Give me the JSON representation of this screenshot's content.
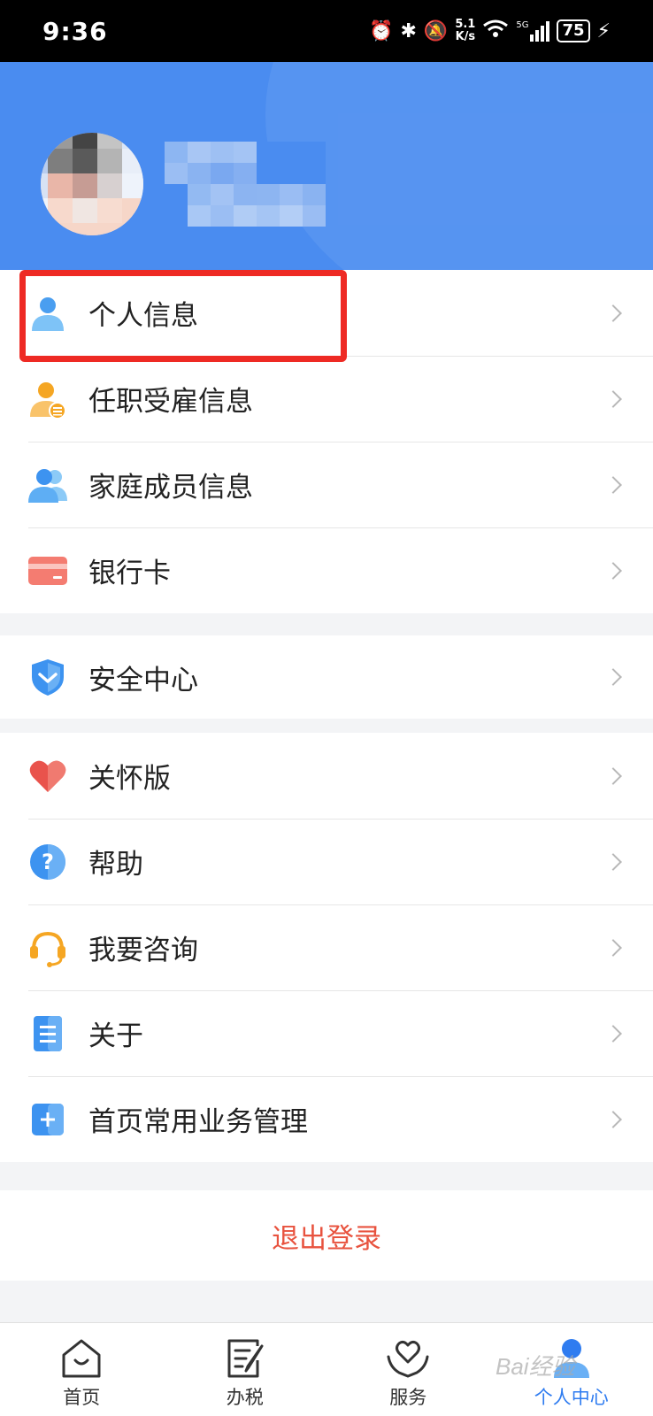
{
  "status_bar": {
    "time": "9:36",
    "network_speed_value": "5.1",
    "network_speed_unit": "K/s",
    "network_type": "5G",
    "battery": "75"
  },
  "menu_group_1": [
    {
      "label": "个人信息",
      "icon": "person-icon",
      "color": "#4aa0f0"
    },
    {
      "label": "任职受雇信息",
      "icon": "employee-icon",
      "color": "#f5a623"
    },
    {
      "label": "家庭成员信息",
      "icon": "family-icon",
      "color": "#4aa0f0"
    },
    {
      "label": "银行卡",
      "icon": "bank-card-icon",
      "color": "#f06b60"
    }
  ],
  "menu_group_2": [
    {
      "label": "安全中心",
      "icon": "shield-icon",
      "color": "#3d93f0"
    }
  ],
  "menu_group_3": [
    {
      "label": "关怀版",
      "icon": "heart-icon",
      "color": "#e9534c"
    },
    {
      "label": "帮助",
      "icon": "help-icon",
      "color": "#3d93f0"
    },
    {
      "label": "我要咨询",
      "icon": "headset-icon",
      "color": "#f5a623"
    },
    {
      "label": "关于",
      "icon": "document-icon",
      "color": "#3d93f0"
    },
    {
      "label": "首页常用业务管理",
      "icon": "plus-square-icon",
      "color": "#3d93f0"
    }
  ],
  "logout": {
    "label": "退出登录",
    "color": "#e8533f"
  },
  "tab_bar": [
    {
      "label": "首页",
      "icon": "home-icon"
    },
    {
      "label": "办税",
      "icon": "edit-document-icon"
    },
    {
      "label": "服务",
      "icon": "heart-hands-icon"
    },
    {
      "label": "个人中心",
      "icon": "person-center-icon",
      "active": true
    }
  ],
  "watermark": "Bai经验",
  "colors": {
    "header_blue": "#4a8cf0",
    "accent_blue": "#2f7cf0",
    "highlight_red": "#ee2a24"
  }
}
